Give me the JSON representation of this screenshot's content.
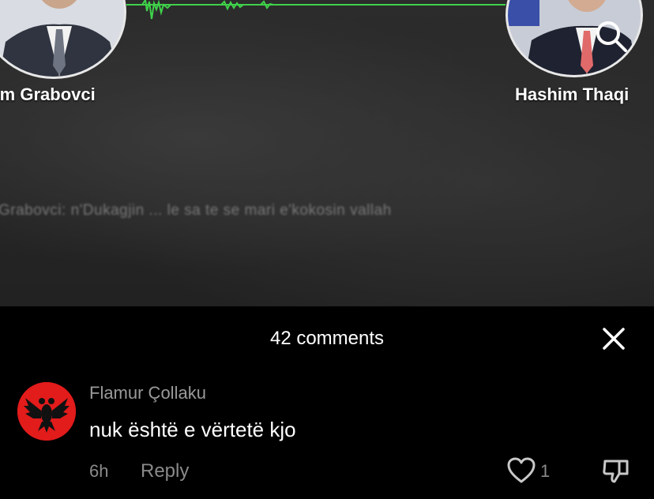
{
  "video": {
    "speaker_left": "dem Grabovci",
    "speaker_right": "Hashim Thaqi",
    "caption": "Grabovci: n'Dukagjin ... le sa te se mari e'kokosin vallah"
  },
  "comments_sheet": {
    "title": "42 comments",
    "comments": [
      {
        "author": "Flamur Çollaku",
        "text": "nuk është e vërtetë kjo",
        "time": "6h",
        "reply_label": "Reply",
        "likes": "1"
      }
    ]
  },
  "icons": {
    "search": "search-icon",
    "close": "close-icon",
    "like": "heart-outline-icon",
    "dislike": "thumbs-down-icon",
    "avatar": "albanian-eagle-icon"
  },
  "colors": {
    "waveform": "#3fd24a",
    "avatar_bg": "#e21b1b",
    "sheet_bg": "#000000"
  }
}
